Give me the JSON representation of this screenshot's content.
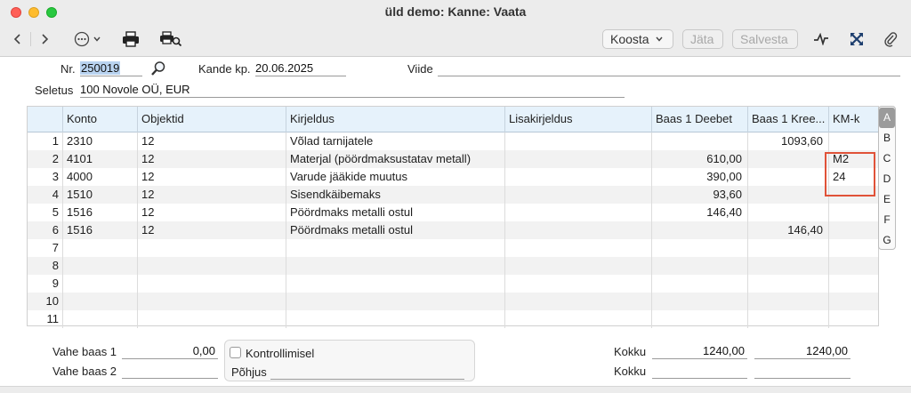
{
  "window": {
    "title": "üld demo: Kanne: Vaata"
  },
  "toolbar": {
    "back_icon": "chevron-left-icon",
    "forward_icon": "chevron-right-icon",
    "koosta_label": "Koosta",
    "jata_label": "Jäta",
    "salvesta_label": "Salvesta"
  },
  "header": {
    "nr_label": "Nr.",
    "nr_value": "250019",
    "kande_kp_label": "Kande kp.",
    "kande_kp_value": "20.06.2025",
    "viide_label": "Viide",
    "viide_value": "",
    "seletus_label": "Seletus",
    "seletus_value": "100 Novole OÜ, EUR"
  },
  "grid": {
    "columns": [
      "Konto",
      "Objektid",
      "Kirjeldus",
      "Lisakirjeldus",
      "Baas 1 Deebet",
      "Baas 1 Kree...",
      "KM-k"
    ],
    "rows": [
      {
        "n": "1",
        "konto": "2310",
        "objektid": "12",
        "kirjeldus": "Võlad tarnijatele",
        "lisakirjeldus": "",
        "deebet": "",
        "kreedit": "1093,60",
        "kmk": ""
      },
      {
        "n": "2",
        "konto": "4101",
        "objektid": "12",
        "kirjeldus": "Materjal (pöördmaksustatav metall)",
        "lisakirjeldus": "",
        "deebet": "610,00",
        "kreedit": "",
        "kmk": "M2"
      },
      {
        "n": "3",
        "konto": "4000",
        "objektid": "12",
        "kirjeldus": "Varude jääkide muutus",
        "lisakirjeldus": "",
        "deebet": "390,00",
        "kreedit": "",
        "kmk": "24"
      },
      {
        "n": "4",
        "konto": "1510",
        "objektid": "12",
        "kirjeldus": "Sisendkäibemaks",
        "lisakirjeldus": "",
        "deebet": "93,60",
        "kreedit": "",
        "kmk": ""
      },
      {
        "n": "5",
        "konto": "1516",
        "objektid": "12",
        "kirjeldus": "Pöördmaks metalli ostul",
        "lisakirjeldus": "",
        "deebet": "146,40",
        "kreedit": "",
        "kmk": ""
      },
      {
        "n": "6",
        "konto": "1516",
        "objektid": "12",
        "kirjeldus": "Pöördmaks metalli ostul",
        "lisakirjeldus": "",
        "deebet": "",
        "kreedit": "146,40",
        "kmk": ""
      },
      {
        "n": "7",
        "konto": "",
        "objektid": "",
        "kirjeldus": "",
        "lisakirjeldus": "",
        "deebet": "",
        "kreedit": "",
        "kmk": ""
      },
      {
        "n": "8",
        "konto": "",
        "objektid": "",
        "kirjeldus": "",
        "lisakirjeldus": "",
        "deebet": "",
        "kreedit": "",
        "kmk": ""
      },
      {
        "n": "9",
        "konto": "",
        "objektid": "",
        "kirjeldus": "",
        "lisakirjeldus": "",
        "deebet": "",
        "kreedit": "",
        "kmk": ""
      },
      {
        "n": "10",
        "konto": "",
        "objektid": "",
        "kirjeldus": "",
        "lisakirjeldus": "",
        "deebet": "",
        "kreedit": "",
        "kmk": ""
      },
      {
        "n": "11",
        "konto": "",
        "objektid": "",
        "kirjeldus": "",
        "lisakirjeldus": "",
        "deebet": "",
        "kreedit": "",
        "kmk": ""
      }
    ]
  },
  "letters": [
    "A",
    "B",
    "C",
    "D",
    "E",
    "F",
    "G"
  ],
  "active_letter": "A",
  "footer": {
    "vahe_baas1_label": "Vahe baas 1",
    "vahe_baas1_value": "0,00",
    "vahe_baas2_label": "Vahe baas 2",
    "vahe_baas2_value": "",
    "kontrollimisel_label": "Kontrollimisel",
    "pohjus_label": "Põhjus",
    "pohjus_value": "",
    "kokku_label": "Kokku",
    "kokku_deebet": "1240,00",
    "kokku_kreedit": "1240,00",
    "kokku2_label": "Kokku",
    "kokku2_deebet": "",
    "kokku2_kreedit": ""
  },
  "colors": {
    "header_bg": "#e6f2fb",
    "highlight_border": "#e05238",
    "selection": "#b9d3f0"
  }
}
